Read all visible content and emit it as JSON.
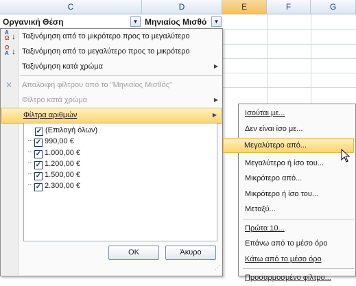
{
  "columns": [
    {
      "label": "C",
      "selected": false
    },
    {
      "label": "D",
      "selected": false
    },
    {
      "label": "E",
      "selected": true
    },
    {
      "label": "F",
      "selected": false
    },
    {
      "label": "G",
      "selected": false
    }
  ],
  "header_cells": {
    "c": "Οργανική Θέση",
    "d": "Μηνιαίος Μισθό"
  },
  "filter_menu": {
    "sort_asc": "Ταξινόμηση από το μικρότερο προς το μεγαλύτερο",
    "sort_desc": "Ταξινόμηση από το μεγαλύτερο προς το μικρότερο",
    "sort_by_color": "Ταξινόμηση κατά χρώμα",
    "clear_filter": "Απαλοιφή φίλτρου από το \"Μηνιαίος Μισθός\"",
    "filter_by_color": "Φίλτρο κατά χρώμα",
    "number_filters": "Φίλτρα αριθμών",
    "values": [
      {
        "label": "(Επιλογή όλων)",
        "checked": true
      },
      {
        "label": "990,00 €",
        "checked": true
      },
      {
        "label": "1.000,00 €",
        "checked": true
      },
      {
        "label": "1.200,00 €",
        "checked": true
      },
      {
        "label": "1.500,00 €",
        "checked": true
      },
      {
        "label": "2.300,00 €",
        "checked": true
      }
    ],
    "ok": "OK",
    "cancel": "Άκυρο"
  },
  "number_filters_menu": [
    "Ισούται με...",
    "Δεν είναι ίσο με...",
    "Μεγαλύτερο από...",
    "Μεγαλύτερο ή ίσο του...",
    "Μικρότερο από...",
    "Μικρότερο ή ίσο του...",
    "Μεταξύ...",
    "Πρώτα 10...",
    "Επάνω από το μέσο όρο",
    "Κάτω από το μέσο όρο",
    "Προσαρμοσμένο φίλτρο..."
  ],
  "highlighted_submenu_index": 2,
  "colors": {
    "highlight": "#fbd46c",
    "header_selected": "#f1c15f",
    "header_text": "#15428b"
  }
}
